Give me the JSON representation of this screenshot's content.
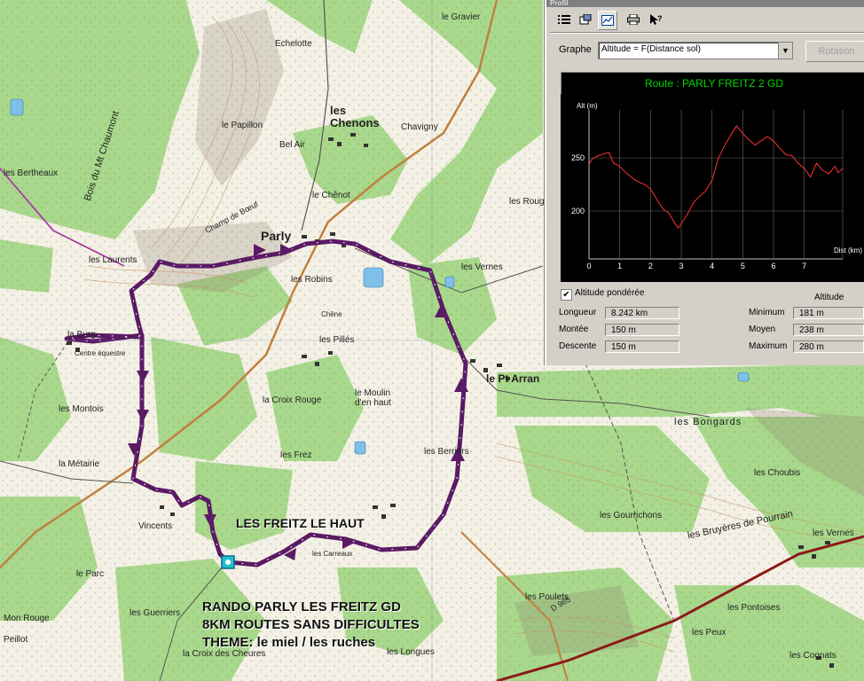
{
  "map": {
    "places": [
      {
        "id": "echelotte",
        "text": "Echelotte"
      },
      {
        "id": "papillon",
        "text": "le Papillon"
      },
      {
        "id": "chenons",
        "text": "les Chenons"
      },
      {
        "id": "chavigny",
        "text": "Chavigny"
      },
      {
        "id": "belair",
        "text": "Bel Air"
      },
      {
        "id": "chenot",
        "text": "le Chênot"
      },
      {
        "id": "gravier",
        "text": "le Gravier"
      },
      {
        "id": "berthaux",
        "text": "les Bertheaux"
      },
      {
        "id": "laurents",
        "text": "les Laurents"
      },
      {
        "id": "parly",
        "text": "Parly"
      },
      {
        "id": "robins",
        "text": "les Robins"
      },
      {
        "id": "vernes",
        "text": "les Vernes"
      },
      {
        "id": "laburg",
        "text": "la Burg"
      },
      {
        "id": "equestre",
        "text": "Centre équestre"
      },
      {
        "id": "pilles",
        "text": "les Pillés"
      },
      {
        "id": "moulin",
        "text": "le Moulin d'en haut"
      },
      {
        "id": "arran",
        "text": "le Pt Arran"
      },
      {
        "id": "croixrouge",
        "text": "la Croix Rouge"
      },
      {
        "id": "montois",
        "text": "les Montois"
      },
      {
        "id": "metairie",
        "text": "la Métairie"
      },
      {
        "id": "frez",
        "text": "les Frez"
      },
      {
        "id": "berries",
        "text": "les Berriers"
      },
      {
        "id": "vincents",
        "text": "Vincents"
      },
      {
        "id": "gourrichons",
        "text": "les Gourrichons"
      },
      {
        "id": "bongards",
        "text": "les Bongards"
      },
      {
        "id": "choubis",
        "text": "les Choubis"
      },
      {
        "id": "bruyeres",
        "text": "les Bruyères de Pourrain"
      },
      {
        "id": "pontoises",
        "text": "les Pontoises"
      },
      {
        "id": "poulets",
        "text": "les Poulets"
      },
      {
        "id": "guerriers",
        "text": "les Guerriers"
      },
      {
        "id": "monrouge",
        "text": "Mon Rouge"
      },
      {
        "id": "peillot",
        "text": "Peillot"
      },
      {
        "id": "croixcheures",
        "text": "la Croix des Cheures"
      },
      {
        "id": "longues",
        "text": "les Longues"
      },
      {
        "id": "peux",
        "text": "les Peux"
      },
      {
        "id": "cognats",
        "text": "les Cognats"
      },
      {
        "id": "parc",
        "text": "le Parc"
      },
      {
        "id": "vernes2",
        "text": "les Vernes"
      },
      {
        "id": "champ",
        "text": "Champ de Bœuf"
      },
      {
        "id": "bois",
        "text": "Bois du Mt Chaumont"
      },
      {
        "id": "carreaux",
        "text": "les Carreaux"
      },
      {
        "id": "chesne",
        "text": "Chêne"
      },
      {
        "id": "rougeaux",
        "text": "les Rougeaux"
      },
      {
        "id": "dhuy",
        "text": "D 965"
      }
    ],
    "overlay": {
      "waypoint_label": "LES FREITZ LE HAUT",
      "line1": "RANDO PARLY LES FREITZ GD",
      "line2": "8KM ROUTES SANS DIFFICULTES",
      "line3": "THEME: le miel / les ruches"
    },
    "colors": {
      "route": "#5a1a64",
      "forest": "#a9d88c",
      "road": "#c08040",
      "rail": "#8b1a1a"
    }
  },
  "profile": {
    "title": "Profil",
    "toolbar_icons": [
      "list-icon",
      "window-icon",
      "profile-chart-icon",
      "print-icon",
      "help-icon"
    ],
    "graph_label": "Graphe",
    "graph_select": "Altitude = F(Distance sol)",
    "rotation_label": "Rotation",
    "route_title": "Route : PARLY FREITZ 2 GD",
    "chart": {
      "y_label": "Alt (m)",
      "x_label": "Dist (km)"
    },
    "weighted_altitude_label": "Altitude pondérée",
    "weighted_altitude_checked": true,
    "altitude_header": "Altitude",
    "stats_left": [
      {
        "label": "Longueur",
        "value": "8.242 km"
      },
      {
        "label": "Montée",
        "value": "150 m"
      },
      {
        "label": "Descente",
        "value": "150 m"
      }
    ],
    "stats_right": [
      {
        "label": "Minimum",
        "value": "181 m"
      },
      {
        "label": "Moyen",
        "value": "238 m"
      },
      {
        "label": "Maximum",
        "value": "280 m"
      }
    ]
  },
  "chart_data": {
    "type": "line",
    "title": "Route : PARLY FREITZ 2 GD",
    "xlabel": "Dist (km)",
    "ylabel": "Alt (m)",
    "xlim": [
      0,
      8.25
    ],
    "ylim": [
      155,
      295
    ],
    "xticks": [
      0,
      1,
      2,
      3,
      4,
      5,
      6,
      7
    ],
    "yticks": [
      200,
      250
    ],
    "grid": true,
    "series": [
      {
        "color": "#ff3030",
        "x": [
          0,
          0.1,
          0.3,
          0.5,
          0.65,
          0.8,
          1.0,
          1.2,
          1.5,
          1.8,
          2.0,
          2.2,
          2.4,
          2.6,
          2.8,
          2.9,
          3.0,
          3.2,
          3.4,
          3.6,
          3.8,
          4.0,
          4.2,
          4.4,
          4.6,
          4.8,
          5.0,
          5.2,
          5.4,
          5.6,
          5.8,
          6.0,
          6.2,
          6.4,
          6.6,
          6.8,
          7.0,
          7.2,
          7.4,
          7.6,
          7.8,
          8.0,
          8.1,
          8.24
        ],
        "y": [
          244,
          249,
          252,
          254,
          255,
          245,
          242,
          236,
          229,
          225,
          221,
          211,
          202,
          198,
          188,
          184,
          188,
          197,
          208,
          214,
          219,
          229,
          249,
          261,
          271,
          280,
          273,
          267,
          262,
          266,
          270,
          266,
          259,
          253,
          252,
          245,
          240,
          232,
          245,
          238,
          235,
          242,
          236,
          240
        ]
      }
    ]
  }
}
